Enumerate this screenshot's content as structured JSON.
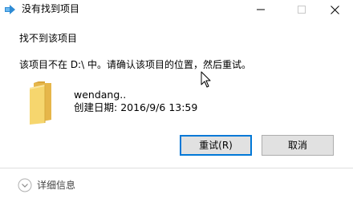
{
  "window": {
    "title": "没有找到项目",
    "icon": "arrow-icon"
  },
  "controls": {
    "minimize_icon": "minimize-icon",
    "maximize_icon": "maximize-icon",
    "close_icon": "close-icon"
  },
  "content": {
    "heading": "找不到该项目",
    "message": "该项目不在 D:\\ 中。请确认该项目的位置，然后重试。",
    "item": {
      "name": "wendang..",
      "date_label": "创建日期:",
      "date_value": "2016/9/6 13:59",
      "icon": "folder-icon"
    }
  },
  "buttons": {
    "retry_label": "重试(R)",
    "cancel_label": "取消"
  },
  "footer": {
    "details_label": "详细信息",
    "details_icon": "chevron-down-icon"
  },
  "colors": {
    "focus_border": "#0078d7",
    "button_bg": "#e1e1e1",
    "folder_yellow": "#f6d66e",
    "footer_border": "#dfdfdf"
  }
}
